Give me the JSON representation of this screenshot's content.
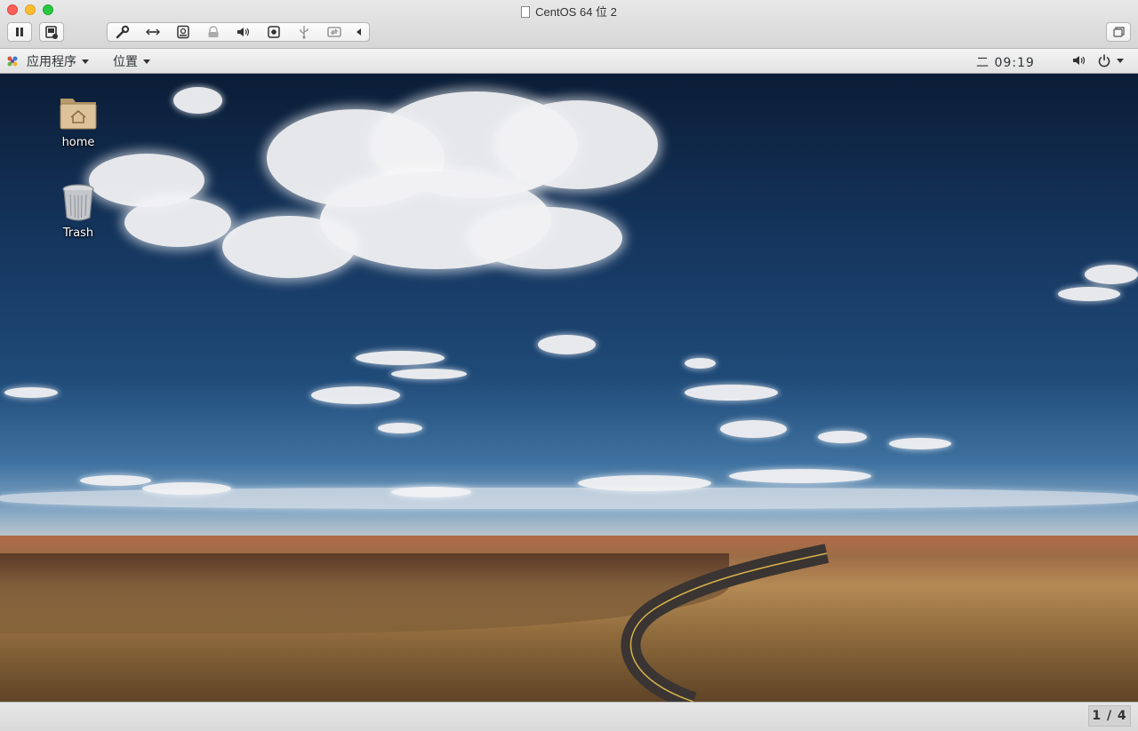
{
  "window": {
    "title": "CentOS 64 位 2"
  },
  "toolbar": {
    "icons": [
      "pause-icon",
      "snapshot-icon",
      "wrench-icon",
      "network-arrows-icon",
      "harddisk-icon",
      "lock-icon",
      "volume-icon",
      "camera-icon",
      "usb-icon",
      "sync-icon",
      "collapse-arrow-icon",
      "restore-window-icon"
    ]
  },
  "panel": {
    "applications_label": "应用程序",
    "places_label": "位置",
    "clock": "二 09:19"
  },
  "desktop": {
    "icons": [
      {
        "label": "home",
        "icon": "home-folder-icon"
      },
      {
        "label": "Trash",
        "icon": "trash-icon"
      }
    ]
  },
  "statusbar": {
    "page_indicator": "1 / 4"
  }
}
